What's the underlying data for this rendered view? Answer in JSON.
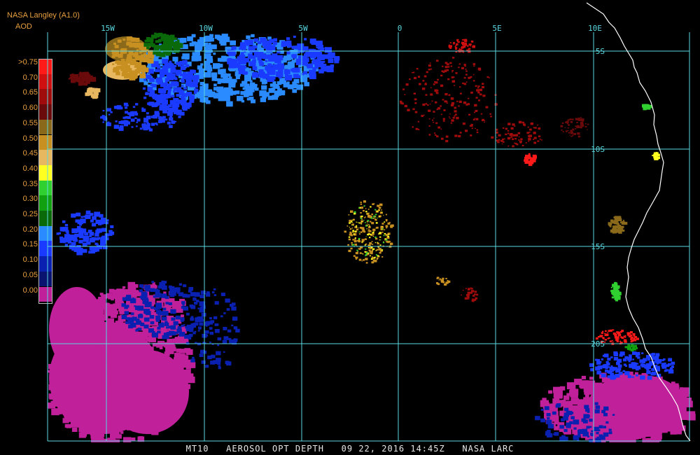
{
  "header": {
    "title": "NASA Langley (A1.0)",
    "subtitle": "AOD"
  },
  "legend": {
    "labels": [
      ">0.75",
      "0.70",
      "0.65",
      "0.60",
      "0.55",
      "0.50",
      "0.45",
      "0.40",
      "0.35",
      "0.30",
      "0.25",
      "0.20",
      "0.15",
      "0.10",
      "0.05",
      "0.00"
    ],
    "colors": [
      "#ff1a1a",
      "#d01010",
      "#a00c0c",
      "#6a0a0a",
      "#8a6a1a",
      "#c89020",
      "#e8b860",
      "#ffff20",
      "#30d030",
      "#10a010",
      "#0a6a0a",
      "#2a8aff",
      "#1a3aff",
      "#0a20b0",
      "#0a1470",
      "#c0209a"
    ]
  },
  "map": {
    "lon_labels": [
      "15W",
      "10W",
      "5W",
      "0",
      "5E",
      "10E"
    ],
    "lat_labels": [
      "5S",
      "10S",
      "15S",
      "20S"
    ],
    "grid_color": "#5ad8e0",
    "coast_color": "#ffffff"
  },
  "footer": {
    "text": "MT10   AEROSOL OPT DEPTH   09 22, 2016 14:45Z   NASA LARC"
  }
}
